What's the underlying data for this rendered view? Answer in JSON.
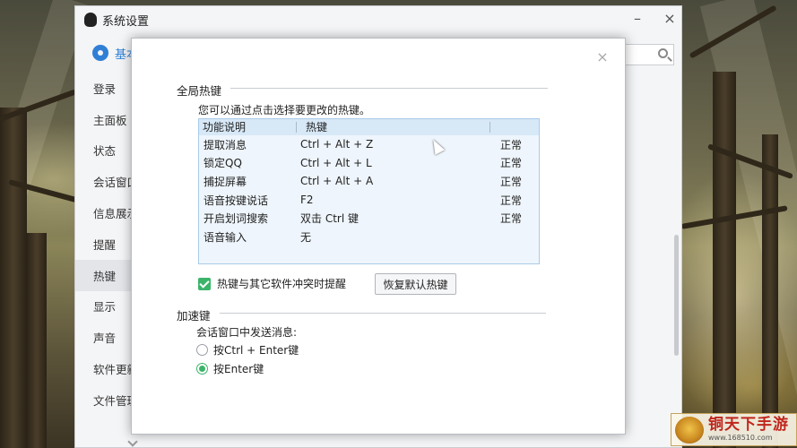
{
  "main_window": {
    "title": "系统设置",
    "tab_label": "基本",
    "sidebar_items": [
      "登录",
      "主面板",
      "状态",
      "会话窗口",
      "信息展示",
      "提醒",
      "热键",
      "显示",
      "声音",
      "软件更新",
      "文件管理"
    ],
    "active_item": "热键"
  },
  "dialog": {
    "close_symbol": "×",
    "global_section_title": "全局热键",
    "hint": "您可以通过点击选择要更改的热键。",
    "table": {
      "columns": [
        "功能说明",
        "热键"
      ],
      "rows": [
        {
          "function": "提取消息",
          "hotkey": "Ctrl + Alt + Z",
          "status": "正常"
        },
        {
          "function": "锁定QQ",
          "hotkey": "Ctrl + Alt + L",
          "status": "正常"
        },
        {
          "function": "捕捉屏幕",
          "hotkey": "Ctrl + Alt + A",
          "status": "正常"
        },
        {
          "function": "语音按键说话",
          "hotkey": "F2",
          "status": "正常"
        },
        {
          "function": "开启划词搜索",
          "hotkey": "双击 Ctrl 键",
          "status": "正常"
        },
        {
          "function": "语音输入",
          "hotkey": "无",
          "status": ""
        }
      ]
    },
    "conflict_checkbox_label": "热键与其它软件冲突时提醒",
    "conflict_checked": true,
    "restore_button": "恢复默认热键",
    "accel_section_title": "加速键",
    "send_message_label": "会话窗口中发送消息:",
    "send_options": [
      {
        "label": "按Ctrl + Enter键",
        "selected": false
      },
      {
        "label": "按Enter键",
        "selected": true
      }
    ]
  },
  "watermark": {
    "brand": "铜天下手游",
    "url": "www.168510.com"
  },
  "colors": {
    "accent_blue": "#2f7fd6",
    "check_green": "#3bb46a",
    "table_header": "#d7e8f7",
    "table_body": "#eef5fc"
  }
}
